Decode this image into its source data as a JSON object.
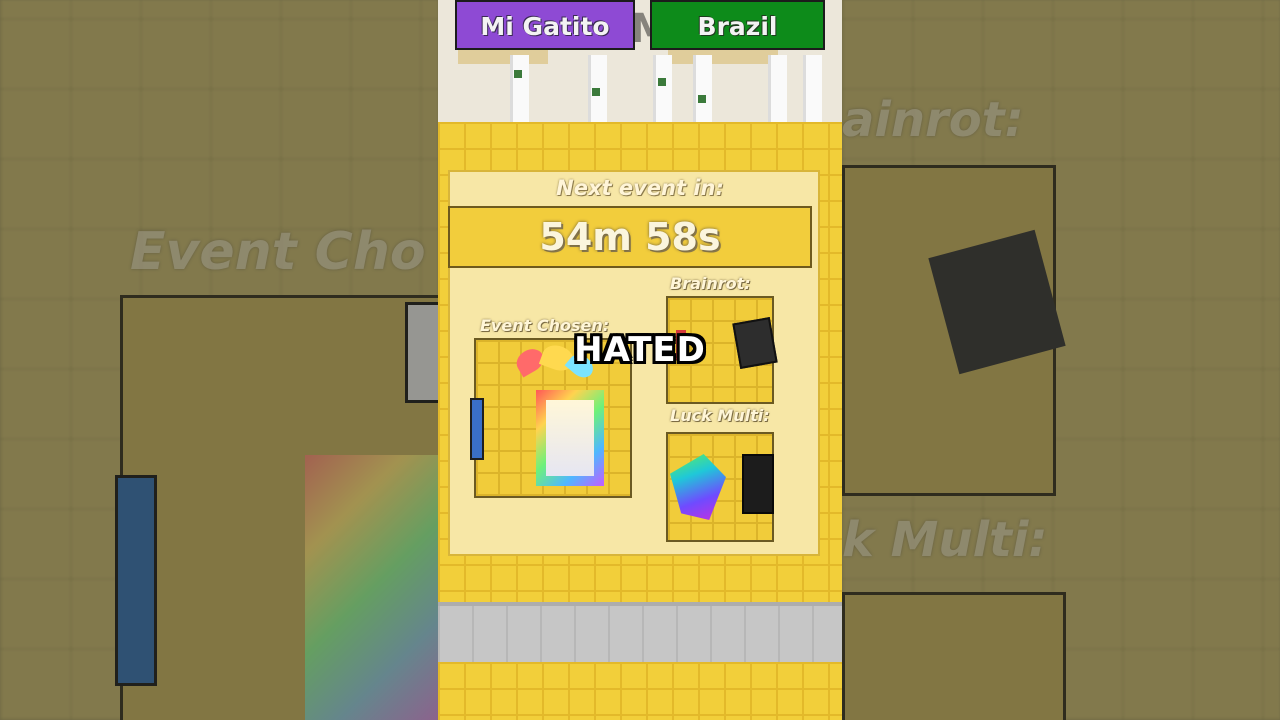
{
  "top_tags": {
    "left": "Mi Gatito",
    "right": "Brazil"
  },
  "board": {
    "next_event_label": "Next event in:",
    "timer": "54m 58s",
    "event_chosen_label": "Event Chosen:",
    "brainrot_label": "Brainrot:",
    "luck_multi_label": "Luck Multi:"
  },
  "background_side": {
    "left_text": "Event Cho",
    "right_top_text": "ainrot:",
    "right_bottom_text": "k Multi:"
  },
  "caption": "HATED",
  "colors": {
    "tag_left": "#8e4ad4",
    "tag_right": "#0d8b1a",
    "board_gold": "#f2cf3a"
  }
}
